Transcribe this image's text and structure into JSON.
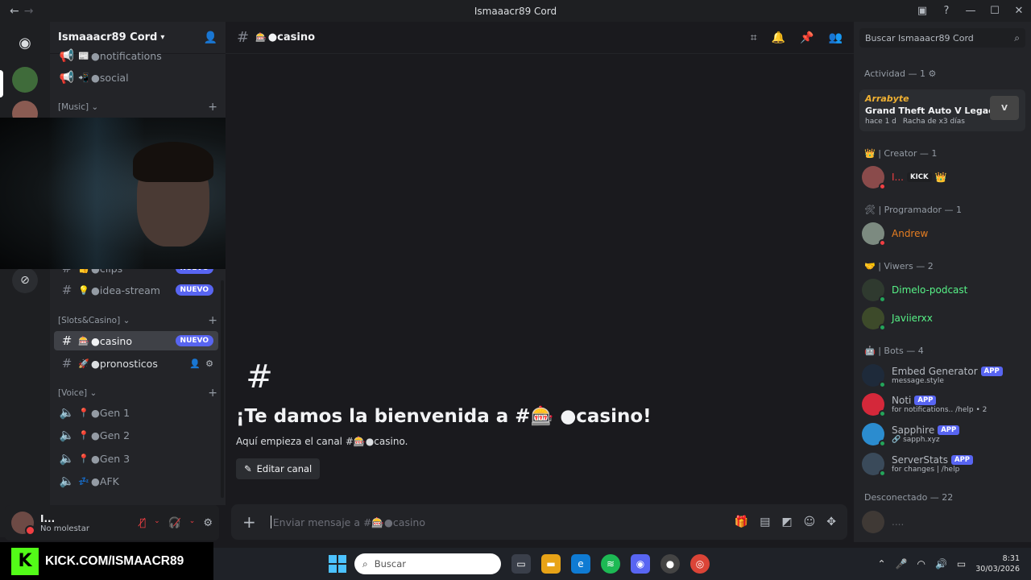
{
  "window": {
    "title": "Ismaaacr89 Cord"
  },
  "server": {
    "name": "Ismaaacr89 Cord"
  },
  "channels": {
    "top": [
      {
        "name": "●notifications",
        "emoji": "📰"
      },
      {
        "name": "●social",
        "emoji": "📲"
      }
    ],
    "cat_music": "[Music]",
    "clips": {
      "name": "●clips",
      "emoji": "👍"
    },
    "idea": {
      "name": "●idea-stream",
      "emoji": "💡",
      "badge": "NUEVO"
    },
    "cat_slots": "[Slots&Casino]",
    "casino": {
      "name": "●casino",
      "emoji": "🎰",
      "badge": "NUEVO"
    },
    "pronosticos": {
      "name": "●pronosticos",
      "emoji": "🚀"
    },
    "cat_voice": "[Voice]",
    "voice": [
      {
        "name": "●Gen 1",
        "emoji": "📍"
      },
      {
        "name": "●Gen 2",
        "emoji": "📍"
      },
      {
        "name": "●Gen 3",
        "emoji": "📍"
      },
      {
        "name": "●AFK",
        "emoji": "💤"
      }
    ]
  },
  "user": {
    "name": "I...",
    "status": "No molestar"
  },
  "stream": {
    "kick_url": "KICK.COM/ISMAACR89",
    "kick_letter": "K"
  },
  "main": {
    "channel_emoji": "🎰",
    "channel_name": "●casino",
    "welcome_hash": "#",
    "welcome_title": "¡Te damos la bienvenida a #🎰 ●casino!",
    "welcome_sub": "Aquí empieza el canal #🎰●casino.",
    "edit_button": "Editar canal",
    "composer_placeholder": "Enviar mensaje a #🎰●casino"
  },
  "members_panel": {
    "search_placeholder": "Buscar Ismaaacr89 Cord",
    "activity_head": "Actividad — 1",
    "activity": {
      "user": "Arrabyte",
      "game": "Grand Theft Auto V Legacy",
      "time": "hace 1 d",
      "streak": "Racha de x3 días",
      "thumb": "V"
    },
    "creator_head": "👑 | Creator — 1",
    "creator": {
      "name": "I...",
      "tag": "KICK",
      "color": "#f23f43"
    },
    "prog_head": "🛠 | Programador — 1",
    "prog": {
      "name": "Andrew",
      "color": "#e67e22"
    },
    "viewers_head": "🤝 | Viwers — 2",
    "viewers": [
      {
        "name": "Dimelo-podcast",
        "color": "#57f287"
      },
      {
        "name": "Javiierxx",
        "color": "#57f287"
      }
    ],
    "bots_head": "🤖 | Bots — 4",
    "bots": [
      {
        "name": "Embed Generator",
        "tag": "APP",
        "sub": "message.style"
      },
      {
        "name": "Noti",
        "tag": "APP",
        "sub": "for notifications.. /help • 2"
      },
      {
        "name": "Sapphire",
        "tag": "APP",
        "sub": "🔗 sapph.xyz"
      },
      {
        "name": "ServerStats",
        "tag": "APP",
        "sub": "for changes | /help"
      }
    ],
    "offline_head": "Desconectado — 22",
    "offline_first": "...."
  },
  "taskbar": {
    "search_label": "Buscar",
    "time": "8:31",
    "date": "30/03/2026"
  },
  "colors": {
    "accent": "#5865f2",
    "online": "#23a55a",
    "dnd": "#f23f43",
    "kick": "#53fc18"
  }
}
